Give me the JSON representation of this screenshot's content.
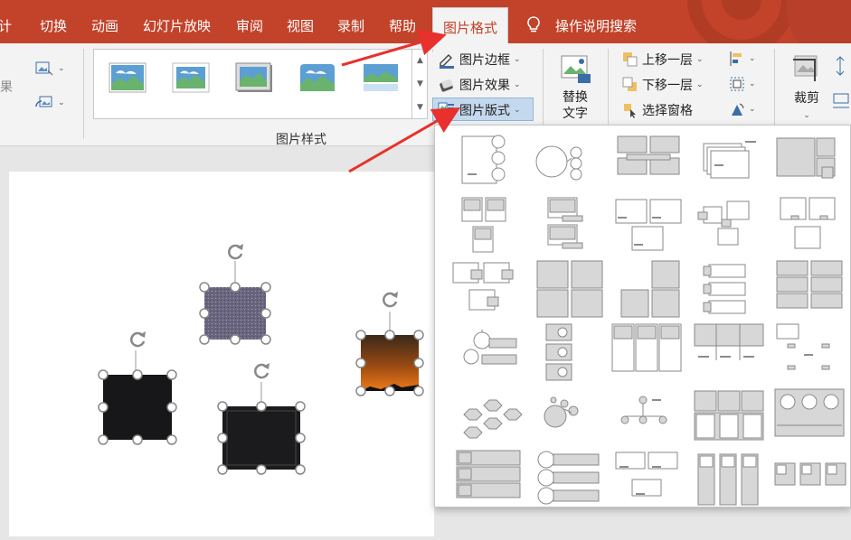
{
  "tabs": [
    "计",
    "切换",
    "动画",
    "幻灯片放映",
    "审阅",
    "视图",
    "录制",
    "帮助"
  ],
  "active_tab": "图片格式",
  "tell_me": "操作说明搜索",
  "ribbon": {
    "left_truncated": "果",
    "border": "图片边框",
    "effects": "图片效果",
    "layout": "图片版式",
    "alt_text_line1": "替换",
    "alt_text_line2": "文字",
    "bring_forward": "上移一层",
    "send_backward": "下移一层",
    "selection_pane": "选择窗格",
    "crop": "裁剪",
    "group_label": "图片样式"
  },
  "colors": {
    "accent": "#c2432a",
    "arrow": "#e8302c",
    "highlight": "#c5d9ee"
  },
  "layout_gallery": {
    "rows": 6,
    "columns": 5,
    "items": [
      "bending-picture-accent-list",
      "circular-picture-callout",
      "picture-grid",
      "picture-frame-stack",
      "snapshot-picture-list",
      "picture-accent-list",
      "picture-caption-list",
      "captioned-pictures",
      "bending-picture-blocks",
      "picture-lineup",
      "alternating-picture-blocks",
      "picture-grid-2",
      "framed-text-picture",
      "vertical-picture-list",
      "picture-organization-blocks",
      "accent-picture",
      "circle-picture-hierarchy",
      "title-picture-lineup",
      "picture-accent-blocks",
      "picture-strips",
      "hexagon-cluster",
      "bubble-picture-list",
      "picture-organization-chart",
      "ascending-picture-accent",
      "phased-process",
      "vertical-picture-accent-list",
      "rounded-picture-list",
      "picture-caption-blocks",
      "title-picture-blocks",
      "picture-accent-process"
    ]
  },
  "slide_pictures": [
    "purple-texture-picture",
    "dark-picture-left",
    "dark-picture-bottom",
    "sunset-picture"
  ]
}
